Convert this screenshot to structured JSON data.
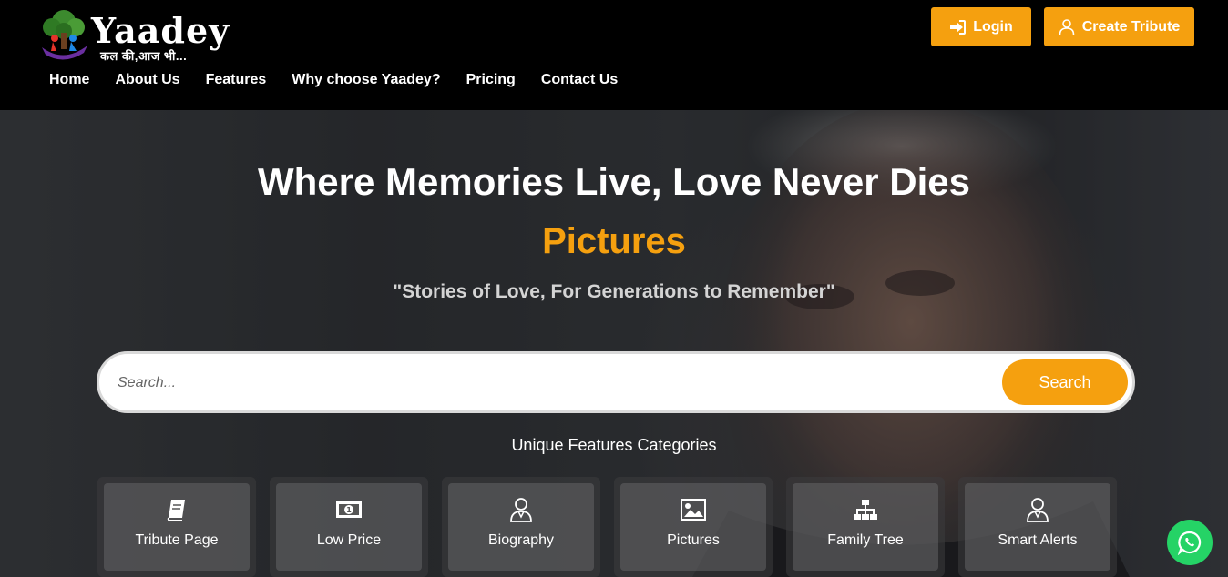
{
  "brand": {
    "name": "Yaadey",
    "tagline": "कल की,आज भी..."
  },
  "nav": [
    "Home",
    "About Us",
    "Features",
    "Why choose Yaadey?",
    "Pricing",
    "Contact Us"
  ],
  "buttons": {
    "login": "Login",
    "create": "Create Tribute"
  },
  "hero": {
    "title": "Where Memories Live, Love Never Dies",
    "rotator": "Pictures",
    "quote": "\"Stories of Love, For Generations to Remember\""
  },
  "search": {
    "placeholder": "Search...",
    "button": "Search"
  },
  "features": {
    "heading": "Unique Features Categories",
    "items": [
      {
        "label": "Tribute Page",
        "icon": "book-icon"
      },
      {
        "label": "Low Price",
        "icon": "money-icon"
      },
      {
        "label": "Biography",
        "icon": "user-icon"
      },
      {
        "label": "Pictures",
        "icon": "image-icon"
      },
      {
        "label": "Family Tree",
        "icon": "sitemap-icon"
      },
      {
        "label": "Smart Alerts",
        "icon": "user-icon"
      }
    ]
  },
  "colors": {
    "accent": "#f5a00f",
    "header": "#000000",
    "whatsapp": "#25d366"
  }
}
